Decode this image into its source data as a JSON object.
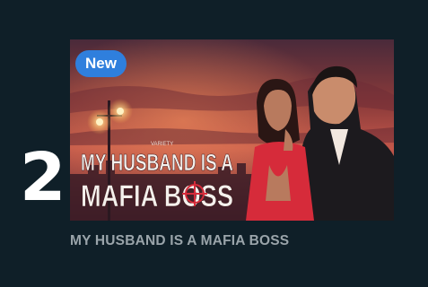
{
  "item": {
    "rank": "2",
    "badge": "New",
    "title": "MY HUSBAND IS A MAFIA BOSS",
    "poster_title_line1": "MY HUSBAND IS A",
    "poster_title_line2": "MAFIA BOSS",
    "poster_small_text": "VARIETY"
  },
  "colors": {
    "page_background": "#0f1f28",
    "badge_background": "#2f7fdd",
    "rank_text": "#ffffff",
    "title_text": "#9aa4aa"
  }
}
